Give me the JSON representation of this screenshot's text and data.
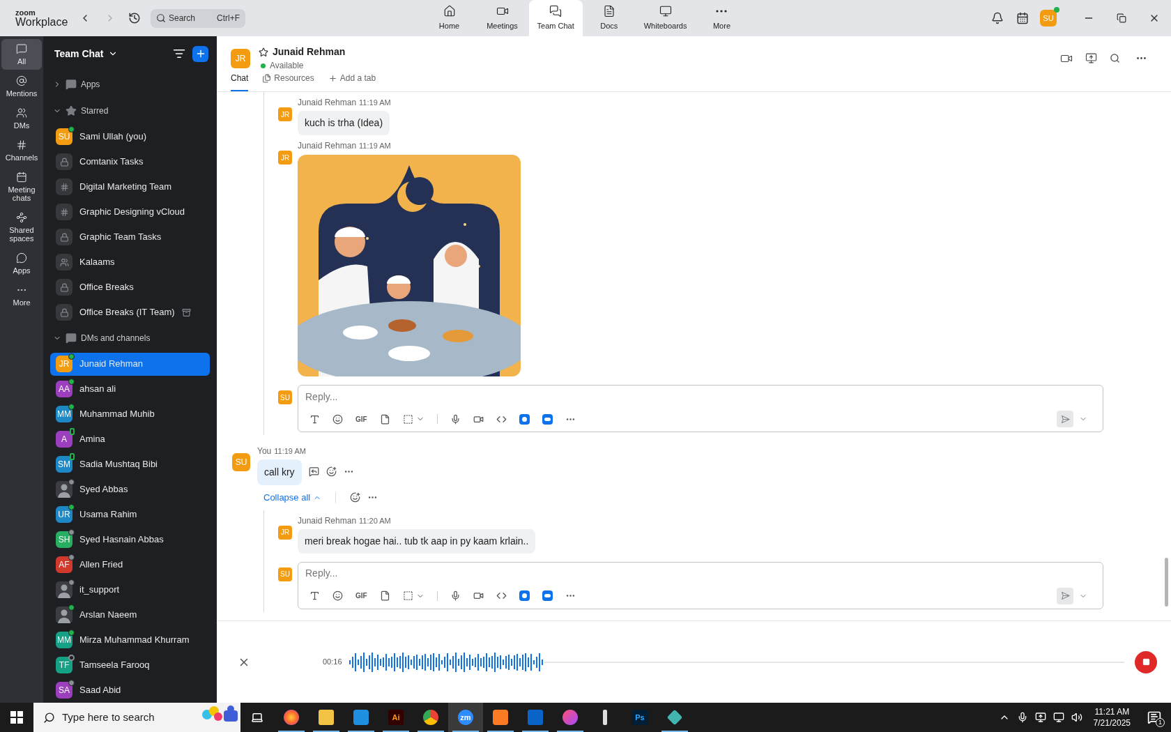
{
  "titlebar": {
    "logo_top": "zoom",
    "logo_bottom": "Workplace",
    "search": {
      "placeholder": "Search",
      "shortcut": "Ctrl+F"
    },
    "tabs": [
      {
        "kind": "home",
        "label": "Home",
        "selected": false
      },
      {
        "kind": "meetings",
        "label": "Meetings",
        "selected": false
      },
      {
        "kind": "chat",
        "label": "Team Chat",
        "selected": true
      },
      {
        "kind": "docs",
        "label": "Docs",
        "selected": false
      },
      {
        "kind": "whiteboards",
        "label": "Whiteboards",
        "selected": false
      },
      {
        "kind": "more",
        "label": "More",
        "selected": false
      }
    ],
    "user_initials": "SU"
  },
  "rail": [
    {
      "kind": "all",
      "label": "All",
      "selected": true
    },
    {
      "kind": "mentions",
      "label": "Mentions",
      "selected": false
    },
    {
      "kind": "dms",
      "label": "DMs",
      "selected": false
    },
    {
      "kind": "channels",
      "label": "Channels",
      "selected": false
    },
    {
      "kind": "meetings",
      "label": "Meeting chats",
      "selected": false
    },
    {
      "kind": "spaces",
      "label": "Shared spaces",
      "selected": false
    },
    {
      "kind": "apps",
      "label": "Apps",
      "selected": false
    },
    {
      "kind": "more",
      "label": "More",
      "selected": false
    }
  ],
  "sidebar": {
    "title": "Team Chat",
    "sections": [
      {
        "kind": "apps",
        "label": "Apps",
        "expanded": false
      },
      {
        "kind": "starred",
        "label": "Starred",
        "expanded": true,
        "items": [
          {
            "name": "Sami Ullah (you)",
            "kind": "avatar",
            "initials": "SU",
            "color": "#f39c12",
            "presence": {
              "kind": "online"
            },
            "selected": false
          },
          {
            "name": "Comtanix Tasks",
            "kind": "lock",
            "selected": false
          },
          {
            "name": "Digital Marketing Team",
            "kind": "hash",
            "selected": false
          },
          {
            "name": "Graphic Designing vCloud",
            "kind": "hash",
            "selected": false
          },
          {
            "name": "Graphic Team Tasks",
            "kind": "lock",
            "selected": false
          },
          {
            "name": "Kalaams",
            "kind": "group",
            "selected": false
          },
          {
            "name": "Office Breaks",
            "kind": "lock",
            "selected": false
          },
          {
            "name": "Office Breaks (IT Team)",
            "kind": "lock",
            "archived": true,
            "selected": false
          }
        ]
      },
      {
        "kind": "dms",
        "label": "DMs and channels",
        "expanded": true,
        "items": [
          {
            "name": "Junaid Rehman",
            "kind": "avatar",
            "initials": "JR",
            "color": "#f39c12",
            "presence": {
              "kind": "online"
            },
            "selected": true
          },
          {
            "name": "ahsan ali",
            "kind": "avatar",
            "initials": "AA",
            "color": "#9b3fbf",
            "presence": {
              "kind": "online"
            },
            "selected": false
          },
          {
            "name": "Muhammad Muhib",
            "kind": "avatar",
            "initials": "MM",
            "color": "#1e88c7",
            "presence": {
              "kind": "online"
            },
            "selected": false
          },
          {
            "name": "Amina",
            "kind": "avatar",
            "initials": "A",
            "color": "#9b3fbf",
            "presence": {
              "kind": "mobile"
            },
            "selected": false
          },
          {
            "name": "Sadia Mushtaq Bibi",
            "kind": "avatar",
            "initials": "SM",
            "color": "#1e88c7",
            "presence": {
              "kind": "mobile"
            },
            "selected": false
          },
          {
            "name": "Syed Abbas",
            "presence": {
              "kind": "away"
            },
            "selected": false
          },
          {
            "name": "Usama Rahim",
            "kind": "avatar",
            "initials": "UR",
            "color": "#1e88c7",
            "presence": {
              "kind": "online"
            },
            "selected": false
          },
          {
            "name": "Syed Hasnain Abbas",
            "kind": "avatar",
            "initials": "SH",
            "color": "#27ae60",
            "presence": {
              "kind": "away"
            },
            "selected": false
          },
          {
            "name": "Allen Fried",
            "kind": "avatar",
            "initials": "AF",
            "color": "#d0392b",
            "presence": {
              "kind": "away"
            },
            "selected": false
          },
          {
            "name": "it_support",
            "presence": {
              "kind": "away"
            },
            "selected": false
          },
          {
            "name": "Arslan Naeem",
            "presence": {
              "kind": "online"
            },
            "selected": false
          },
          {
            "name": "Mirza Muhammad Khurram",
            "kind": "avatar",
            "initials": "MM",
            "color": "#16a085",
            "presence": {
              "kind": "online"
            },
            "selected": false
          },
          {
            "name": "Tamseela Farooq",
            "kind": "avatar",
            "initials": "TF",
            "color": "#16a085",
            "presence": {
              "kind": "offline"
            },
            "selected": false
          },
          {
            "name": "Saad Abid",
            "kind": "avatar",
            "initials": "SA",
            "color": "#9b3fbf",
            "presence": {
              "kind": "away"
            },
            "selected": false
          }
        ]
      }
    ]
  },
  "chat_header": {
    "initials": "JR",
    "name": "Junaid Rehman",
    "starred": false,
    "status": "Available",
    "tabs": [
      {
        "kind": "chat",
        "label": "Chat",
        "selected": true
      },
      {
        "kind": "resources",
        "label": "Resources",
        "selected": false
      },
      {
        "kind": "add",
        "label": "Add a tab",
        "selected": false
      }
    ]
  },
  "threads": [
    {
      "replies": [
        {
          "sender": "Junaid Rehman",
          "time": "11:19 AM",
          "initials": "JR",
          "kind": "text",
          "text": "kuch is trha (Idea)"
        },
        {
          "sender": "Junaid Rehman",
          "time": "11:19 AM",
          "initials": "JR"
        }
      ],
      "reply_box": {
        "initials": "SU",
        "placeholder": "Reply...",
        "gif": "GIF"
      }
    },
    {
      "root": {
        "sender": "You",
        "time": "11:19 AM",
        "initials": "SU",
        "text": "call kry"
      },
      "collapse_label": "Collapse all",
      "replies": [
        {
          "sender": "Junaid Rehman",
          "time": "11:20 AM",
          "initials": "JR",
          "kind": "text",
          "text": "meri break hogae hai.. tub tk aap in py kaam krlain.."
        }
      ],
      "reply_box": {
        "initials": "SU",
        "placeholder": "Reply...",
        "gif": "GIF"
      }
    }
  ],
  "recorder": {
    "time": "00:16"
  },
  "taskbar": {
    "search_placeholder": "Type here to search",
    "apps": [
      {
        "kind": "firefox",
        "running": true,
        "selected": false
      },
      {
        "kind": "folder",
        "running": true,
        "selected": false
      },
      {
        "kind": "code",
        "running": true,
        "selected": false
      },
      {
        "kind": "illustrator",
        "label": "Ai",
        "running": true,
        "selected": false
      },
      {
        "kind": "chrome",
        "running": true,
        "selected": false
      },
      {
        "kind": "zoom",
        "label": "zm",
        "running": true,
        "selected": true
      },
      {
        "kind": "xampp",
        "running": true,
        "selected": false
      },
      {
        "kind": "outlook",
        "running": true,
        "selected": false
      },
      {
        "kind": "cloud",
        "running": true,
        "selected": false
      },
      {
        "kind": "pen",
        "running": false,
        "selected": false
      },
      {
        "kind": "photoshop",
        "label": "Ps",
        "running": false,
        "selected": false
      },
      {
        "kind": "diamond",
        "running": true,
        "selected": false
      }
    ],
    "time": "11:21 AM",
    "date": "7/21/2025",
    "notifications": "1"
  }
}
